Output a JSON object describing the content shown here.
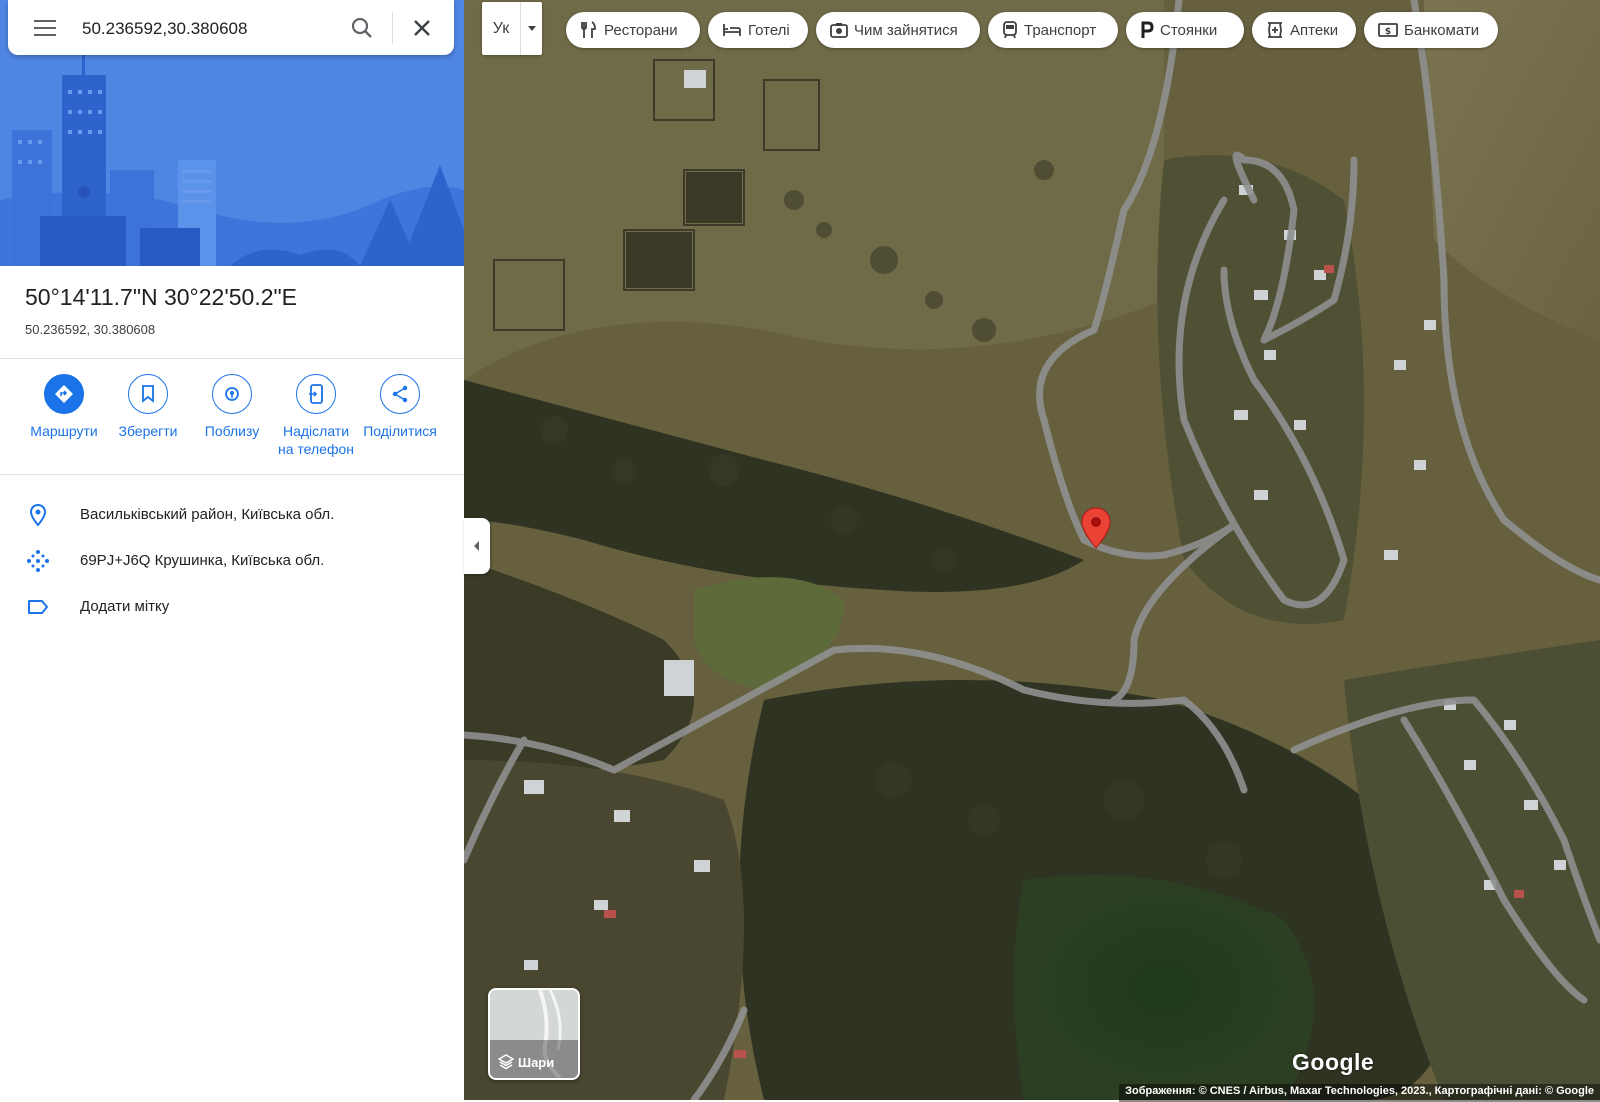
{
  "search": {
    "value": "50.236592,30.380608"
  },
  "place": {
    "title": "50°14'11.7\"N 30°22'50.2\"E",
    "subtitle": "50.236592, 30.380608"
  },
  "actions": [
    {
      "label": "Маршрути",
      "icon": "directions-icon"
    },
    {
      "label": "Зберегти",
      "icon": "bookmark-icon"
    },
    {
      "label": "Поблизу",
      "icon": "nearby-icon"
    },
    {
      "label": "Надіслати на телефон",
      "icon": "send-to-phone-icon"
    },
    {
      "label": "Поділитися",
      "icon": "share-icon"
    }
  ],
  "info": [
    {
      "text": "Васильківський район, Київська обл.",
      "icon": "location-pin-icon"
    },
    {
      "text": "69PJ+J6Q Крушинка, Київська обл.",
      "icon": "plus-code-icon"
    },
    {
      "text": "Додати мітку",
      "icon": "label-icon"
    }
  ],
  "language": {
    "label": "Ук"
  },
  "chips": [
    {
      "label": "Ресторани",
      "icon": "restaurant-icon"
    },
    {
      "label": "Готелі",
      "icon": "hotel-icon"
    },
    {
      "label": "Чим зайнятися",
      "icon": "camera-icon"
    },
    {
      "label": "Транспорт",
      "icon": "transit-icon"
    },
    {
      "label": "Стоянки",
      "icon": "parking-icon"
    },
    {
      "label": "Аптеки",
      "icon": "pharmacy-icon"
    },
    {
      "label": "Банкомати",
      "icon": "atm-icon"
    }
  ],
  "layers": {
    "label": "Шари"
  },
  "map": {
    "logo": "Google",
    "attribution": "Зображення: © CNES / Airbus, Maxar Technologies, 2023., Картографічні дані: © Google",
    "imagery": "satellite",
    "accent": "#1a73e8",
    "pin_color": "#ea4335"
  }
}
